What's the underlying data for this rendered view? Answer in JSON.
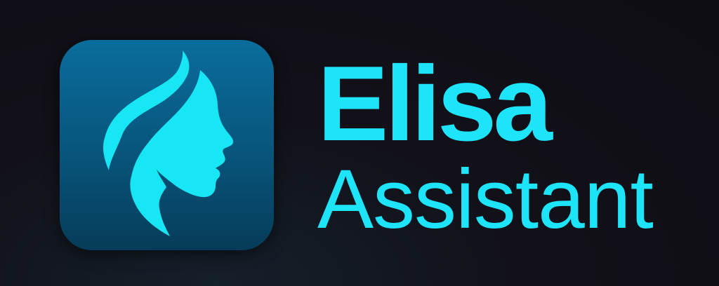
{
  "logo": {
    "title_line1": "Elisa",
    "title_line2": "Assistant",
    "icon": "woman-profile-icon",
    "colors": {
      "accent": "#1de4f8",
      "icon_bg_top": "#0a6d9b",
      "icon_bg_bottom": "#063c59",
      "background": "#110f16"
    }
  }
}
